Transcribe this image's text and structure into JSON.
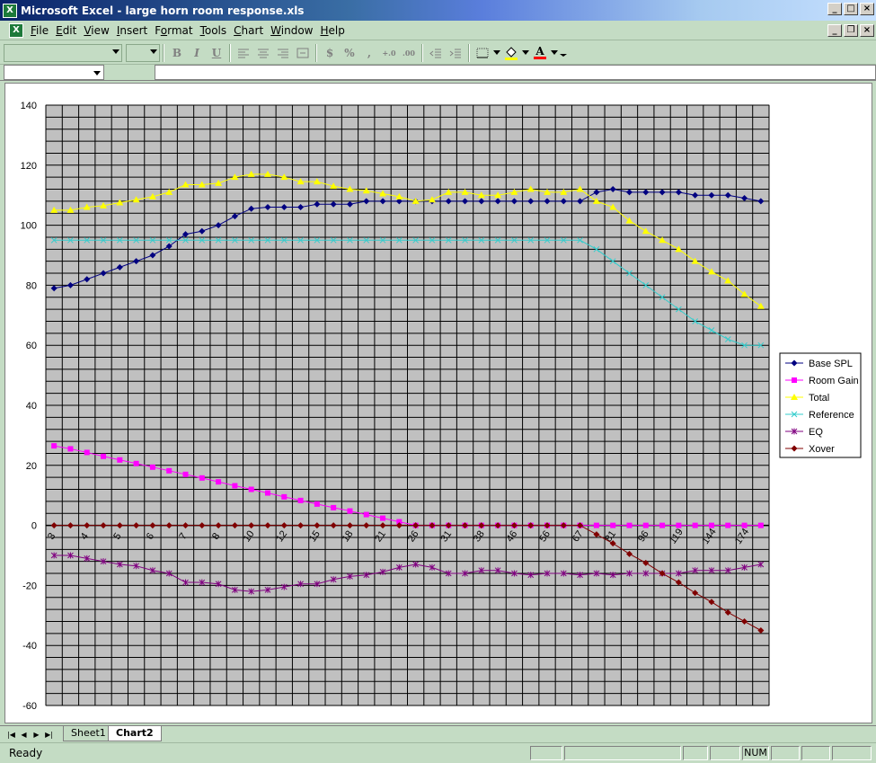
{
  "window": {
    "title": "Microsoft Excel - large horn room response.xls",
    "app_icon": "X"
  },
  "menu": [
    {
      "label": "File",
      "accel": "F"
    },
    {
      "label": "Edit",
      "accel": "E"
    },
    {
      "label": "View",
      "accel": "V"
    },
    {
      "label": "Insert",
      "accel": "I"
    },
    {
      "label": "Format",
      "accel": "o"
    },
    {
      "label": "Tools",
      "accel": "T"
    },
    {
      "label": "Chart",
      "accel": "C"
    },
    {
      "label": "Window",
      "accel": "W"
    },
    {
      "label": "Help",
      "accel": "H"
    }
  ],
  "toolbar": {
    "bold": "B",
    "italic": "I",
    "underline": "U",
    "currency": "$",
    "percent": "%",
    "comma": ",",
    "increase_decimal": "+.0",
    "decrease_decimal": ".00",
    "font_color": "A"
  },
  "tabs": [
    {
      "label": "Sheet1",
      "active": false
    },
    {
      "label": "Chart2",
      "active": true
    }
  ],
  "status": {
    "text": "Ready",
    "num": "NUM"
  },
  "chart_data": {
    "type": "line",
    "ylim": [
      -60,
      140
    ],
    "yticks": [
      140,
      120,
      100,
      80,
      60,
      40,
      20,
      0,
      -20,
      -40,
      -60
    ],
    "xticks": [
      "3",
      "4",
      "5",
      "6",
      "7",
      "8",
      "10",
      "12",
      "15",
      "18",
      "21",
      "26",
      "31",
      "38",
      "46",
      "56",
      "67",
      "81",
      "96",
      "119",
      "144",
      "174"
    ],
    "point_count": 44,
    "legend_position": "right",
    "plot_background": "#c0c0c0",
    "series": [
      {
        "name": "Base SPL",
        "color": "#000080",
        "marker": "diamond",
        "values": [
          79,
          80,
          82,
          84,
          86,
          88,
          90,
          93,
          97,
          98,
          100,
          103,
          105.5,
          106,
          106,
          106,
          107,
          107,
          107,
          108,
          108,
          108,
          108,
          108,
          108,
          108,
          108,
          108,
          108,
          108,
          108,
          108,
          108,
          111,
          112,
          111,
          111,
          111,
          111,
          110,
          110,
          110,
          109,
          108
        ]
      },
      {
        "name": "Room Gain",
        "color": "#ff00ff",
        "marker": "square",
        "values": [
          26.5,
          25.5,
          24.3,
          23,
          21.8,
          20.6,
          19.4,
          18.2,
          17,
          15.8,
          14.5,
          13.2,
          12,
          10.8,
          9.5,
          8.3,
          7.1,
          5.9,
          4.8,
          3.6,
          2.4,
          1.2,
          0,
          0,
          0,
          0,
          0,
          0,
          0,
          0,
          0,
          0,
          0,
          0,
          0,
          0,
          0,
          0,
          0,
          0,
          0,
          0,
          0,
          0
        ]
      },
      {
        "name": "Total",
        "color": "#ffff00",
        "marker": "triangle",
        "values": [
          105,
          105,
          106,
          106.5,
          107.5,
          108.5,
          109.5,
          111,
          113.5,
          113.5,
          114,
          116,
          117,
          117,
          116,
          114.5,
          114.5,
          113,
          112,
          111.5,
          110.5,
          109.5,
          108,
          108.5,
          111,
          111,
          110,
          110,
          111,
          112,
          111,
          111,
          112,
          108,
          106,
          101.5,
          98,
          95,
          92,
          88,
          84.5,
          81.5,
          77,
          73
        ]
      },
      {
        "name": "Reference",
        "color": "#33cccc",
        "marker": "x",
        "values": [
          95,
          95,
          95,
          95,
          95,
          95,
          95,
          95,
          95,
          95,
          95,
          95,
          95,
          95,
          95,
          95,
          95,
          95,
          95,
          95,
          95,
          95,
          95,
          95,
          95,
          95,
          95,
          95,
          95,
          95,
          95,
          95,
          95,
          92,
          88,
          84,
          80,
          76,
          72,
          68,
          65,
          62,
          60,
          60
        ]
      },
      {
        "name": "EQ",
        "color": "#800080",
        "marker": "star",
        "values": [
          -10,
          -10,
          -11,
          -12,
          -13,
          -13.5,
          -15,
          -16,
          -19,
          -19,
          -19.5,
          -21.5,
          -22,
          -21.5,
          -20.5,
          -19.5,
          -19.5,
          -18,
          -17,
          -16.5,
          -15.5,
          -14,
          -13,
          -14,
          -16,
          -16,
          -15,
          -15,
          -16,
          -16.5,
          -16,
          -16,
          -16.5,
          -16,
          -16.5,
          -16,
          -16,
          -16,
          -16,
          -15,
          -15,
          -15,
          -14,
          -13
        ]
      },
      {
        "name": "Xover",
        "color": "#800000",
        "marker": "diamond",
        "values": [
          0,
          0,
          0,
          0,
          0,
          0,
          0,
          0,
          0,
          0,
          0,
          0,
          0,
          0,
          0,
          0,
          0,
          0,
          0,
          0,
          0,
          0,
          0,
          0,
          0,
          0,
          0,
          0,
          0,
          0,
          0,
          0,
          0,
          -3,
          -6,
          -9.5,
          -12.5,
          -16,
          -19,
          -22.5,
          -25.5,
          -29,
          -32,
          -35
        ]
      }
    ]
  }
}
